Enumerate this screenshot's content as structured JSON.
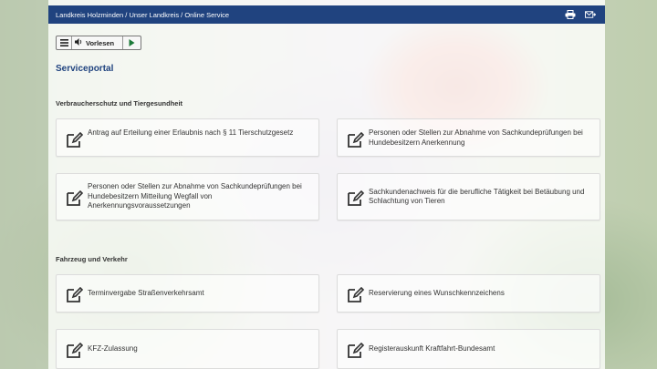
{
  "header": {
    "breadcrumb": "Landkreis Holzminden / Unser Landkreis / Online Service",
    "icons": [
      "print-icon",
      "mail-icon"
    ]
  },
  "toolbar": {
    "read_label": "Vorlesen",
    "icons": [
      "menu-icon",
      "speaker-icon",
      "play-icon"
    ]
  },
  "main": {
    "title": "Serviceportal",
    "sections": [
      {
        "title": "Verbraucherschutz und Tiergesundheit",
        "services": [
          "Antrag auf Erteilung einer Erlaubnis nach § 11 Tierschutzgesetz",
          "Personen oder Stellen zur Abnahme von Sachkundeprüfungen bei Hundebesitzern Anerkennung",
          "Personen oder Stellen zur Abnahme von Sachkundeprüfungen bei Hundebesitzern Mitteilung Wegfall von Anerkennungsvoraussetzungen",
          "Sachkundenachweis für die berufliche Tätigkeit bei Betäubung und Schlachtung von Tieren"
        ]
      },
      {
        "title": "Fahrzeug und Verkehr",
        "services": [
          "Terminvergabe Straßenverkehrsamt",
          "Reservierung eines Wunschkennzeichens",
          "KFZ-Zulassung",
          "Registerauskunft Kraftfahrt-Bundesamt"
        ]
      }
    ]
  },
  "colors": {
    "header_bg": "#20437f",
    "title": "#20437f"
  }
}
